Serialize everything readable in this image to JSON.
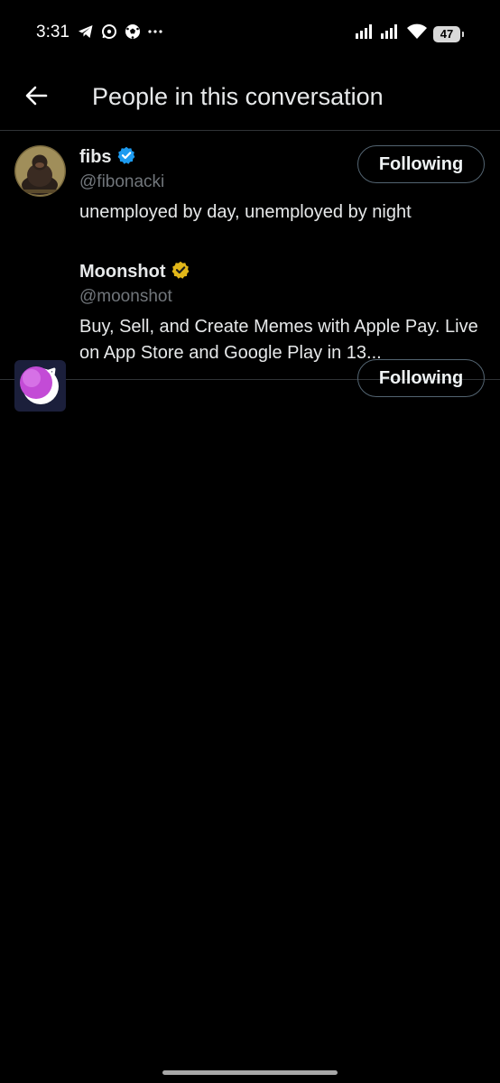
{
  "status_bar": {
    "time": "3:31",
    "left_icons": [
      "telegram-icon",
      "whatsapp-icon",
      "soccer-ball-icon",
      "more-dots-icon"
    ],
    "right_icons": [
      "signal-icon",
      "signal-icon",
      "wifi-icon"
    ],
    "battery": "47"
  },
  "header": {
    "title": "People in this conversation",
    "back_icon": "arrow-left-icon"
  },
  "people": [
    {
      "name": "fibs",
      "handle": "@fibonacki",
      "verified": "blue",
      "bio": "unemployed by day, unemployed by night",
      "follow_label": "Following"
    },
    {
      "name": "Moonshot",
      "handle": "@moonshot",
      "verified": "gold",
      "bio": "Buy, Sell, and Create Memes with Apple Pay. Live on App Store and Google Play in 13...",
      "follow_label": "Following"
    }
  ],
  "colors": {
    "background": "#000000",
    "text": "#e7e9ea",
    "muted": "#71767b",
    "divider": "#2f3336",
    "verified_blue": "#1d9bf0",
    "verified_gold": "#e2b719"
  }
}
